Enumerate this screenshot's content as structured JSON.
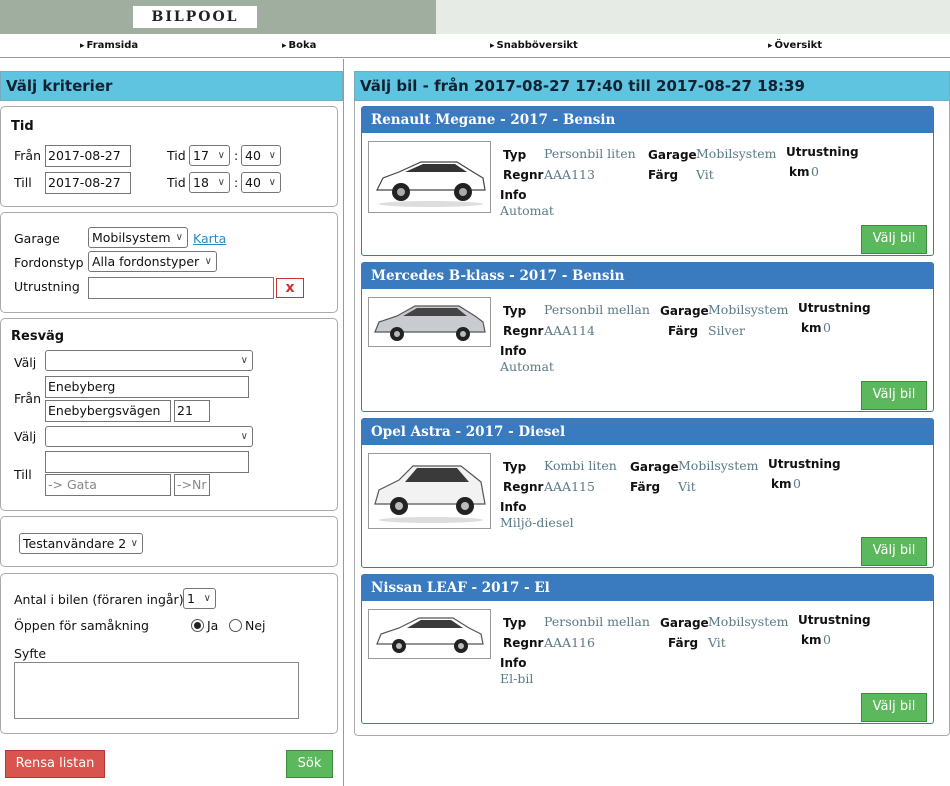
{
  "app": {
    "logo": "BILPOOL"
  },
  "nav": [
    "Framsida",
    "Boka",
    "Snabböversikt",
    "Översikt"
  ],
  "left": {
    "title": "Välj kriterier",
    "tid": {
      "heading": "Tid",
      "from_label": "Från",
      "from_date": "2017-08-27",
      "to_label": "Till",
      "to_date": "2017-08-27",
      "tid_label": "Tid",
      "colon": ":",
      "from_hour": "17",
      "from_min": "40",
      "to_hour": "18",
      "to_min": "40"
    },
    "filters": {
      "garage_label": "Garage",
      "garage_value": "Mobilsystem",
      "map_link": "Karta",
      "type_label": "Fordonstyp",
      "type_value": "Alla fordonstyper",
      "equip_label": "Utrustning",
      "equip_value": "",
      "clear": "x"
    },
    "route": {
      "heading": "Resväg",
      "choose_label": "Välj",
      "from_label": "Från",
      "from_city": "Enebyberg",
      "from_street": "Enebybergsvägen",
      "from_nr": "21",
      "choose2_label": "Välj",
      "to_label": "Till",
      "to_city": "",
      "to_street_placeholder": "-> Gata",
      "to_nr_placeholder": "->Nr"
    },
    "user": {
      "value": "Testanvändare 2"
    },
    "trip": {
      "count_label": "Antal i bilen (föraren ingår)",
      "count_value": "1",
      "share_label": "Öppen för samåkning",
      "yes": "Ja",
      "no": "Nej",
      "share_selected": "Ja",
      "purpose_label": "Syfte"
    },
    "buttons": {
      "clear": "Rensa listan",
      "search": "Sök"
    }
  },
  "right": {
    "title": "Välj bil - från 2017-08-27 17:40 till 2017-08-27 18:39",
    "labels": {
      "typ": "Typ",
      "regnr": "Regnr",
      "info": "Info",
      "garage": "Garage",
      "farg": "Färg",
      "utrustning": "Utrustning",
      "km": "km",
      "choose": "Välj bil"
    },
    "cars": [
      {
        "name": "Renault Megane -  2017 -  Bensin",
        "typ": "Personbil liten",
        "regnr": "AAA113",
        "info": "Automat",
        "garage": "Mobilsystem",
        "farg": "Vit",
        "km": "0",
        "color": "#ffffff"
      },
      {
        "name": "Mercedes B-klass -  2017 -  Bensin",
        "typ": "Personbil mellan",
        "regnr": "AAA114",
        "info": "Automat",
        "garage": "Mobilsystem",
        "farg": "Silver",
        "km": "0",
        "color": "#c8ccd0"
      },
      {
        "name": "Opel Astra -  2017 -  Diesel",
        "typ": "Kombi liten",
        "regnr": "AAA115",
        "info": "Miljö-diesel",
        "garage": "Mobilsystem",
        "farg": "Vit",
        "km": "0",
        "color": "#f2f2f2"
      },
      {
        "name": "Nissan LEAF -  2017 -  El",
        "typ": "Personbil mellan",
        "regnr": "AAA116",
        "info": "El-bil",
        "garage": "Mobilsystem",
        "farg": "Vit",
        "km": "0",
        "color": "#ffffff"
      }
    ]
  }
}
